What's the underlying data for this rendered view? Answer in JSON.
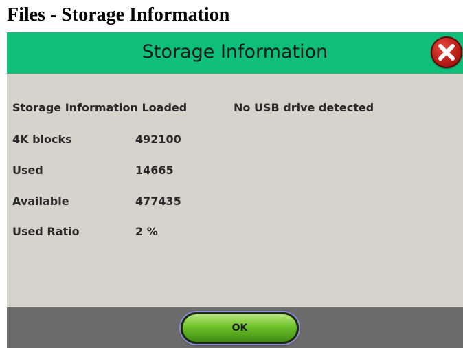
{
  "page": {
    "title": "Files - Storage Information"
  },
  "dialog": {
    "title": "Storage Information",
    "close_icon": "close-icon",
    "status": "Storage Information Loaded",
    "usb_status": "No USB drive detected",
    "rows": [
      {
        "label": "4K blocks",
        "value": "492100"
      },
      {
        "label": "Used",
        "value": "14665"
      },
      {
        "label": "Available",
        "value": "477435"
      },
      {
        "label": "Used Ratio",
        "value": "2 %"
      }
    ],
    "ok_label": "OK"
  },
  "colors": {
    "titlebar": "#10bf7a",
    "panel": "#d6d2cc",
    "footer": "#6b6b6b",
    "ok_button": "#6fc12b",
    "close_button": "#b81d16"
  }
}
